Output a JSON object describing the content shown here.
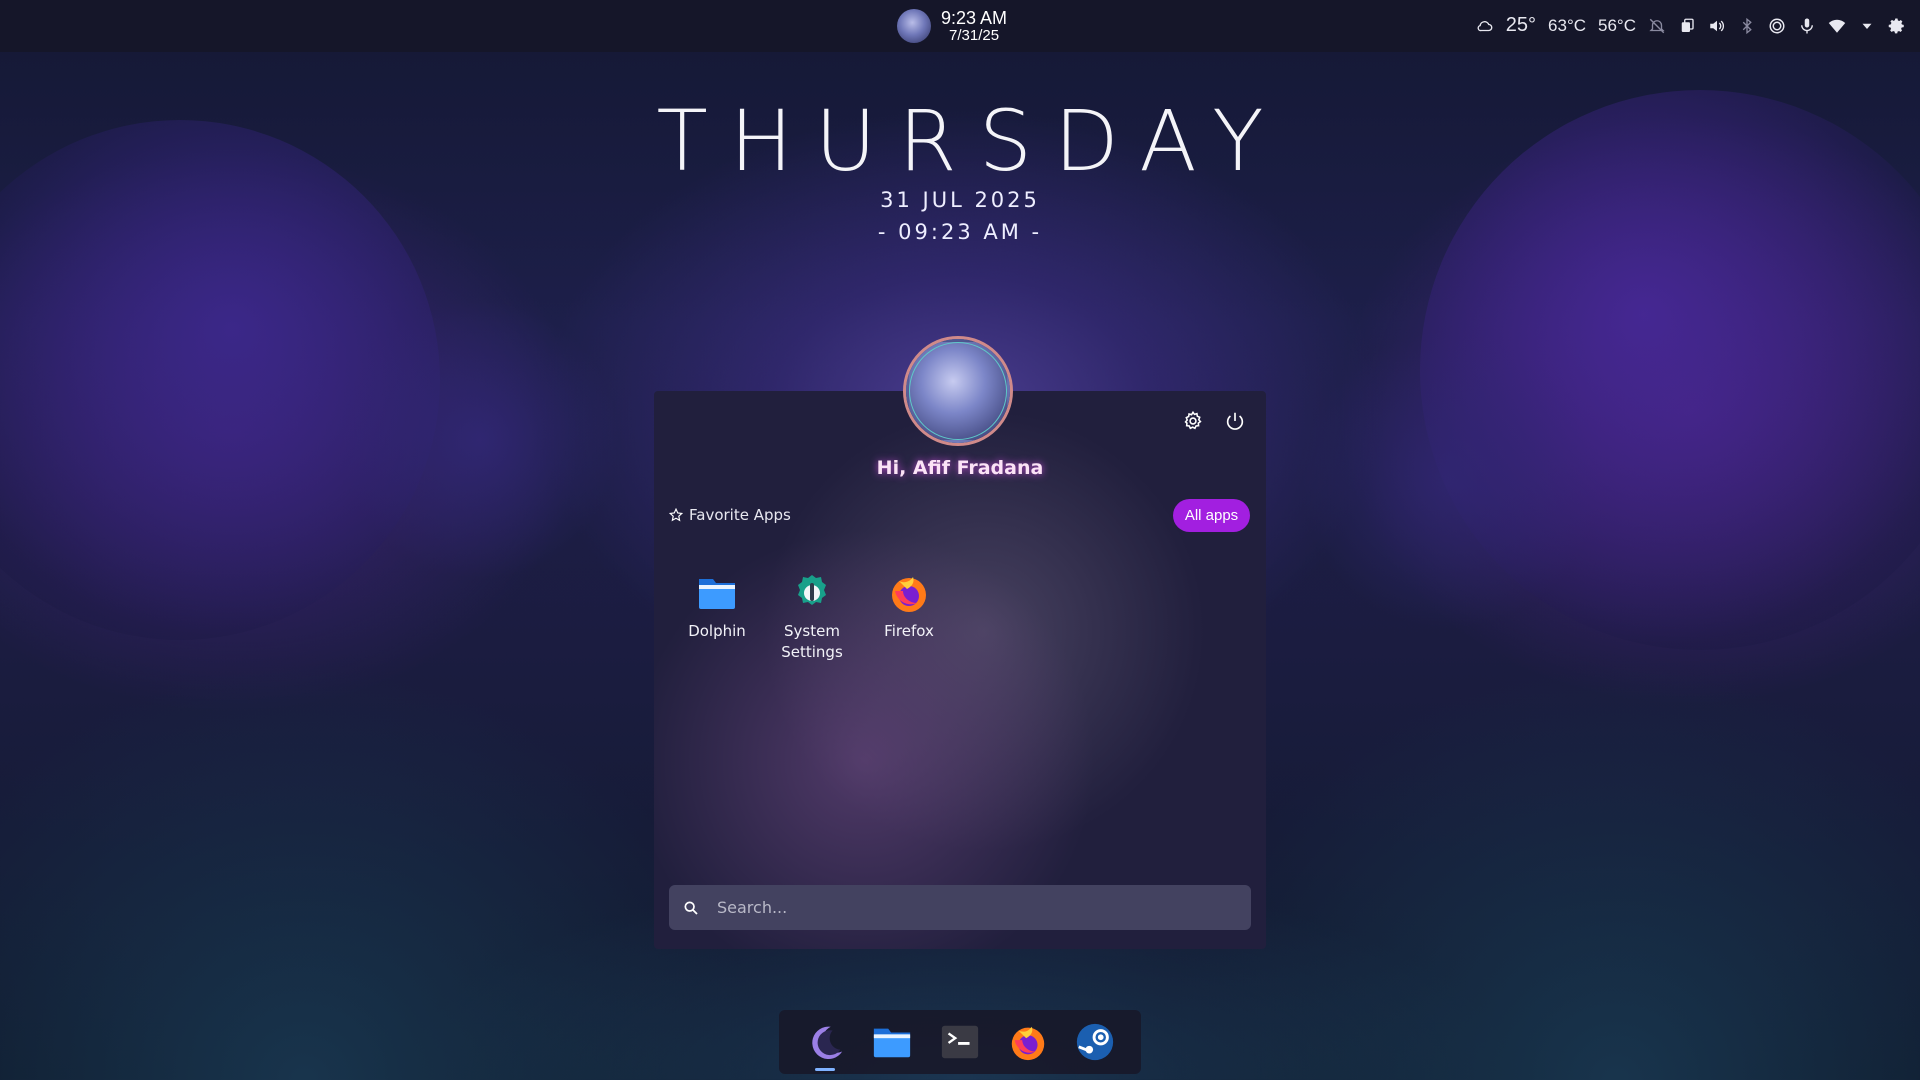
{
  "top_panel": {
    "clock_time": "9:23 AM",
    "clock_date": "7/31/25",
    "weather_temp": "25°",
    "cpu_temp": "63°C",
    "gpu_temp": "56°C",
    "tray_icons": [
      "weather-cloud-icon",
      "notifications-off-icon",
      "clipboard-icon",
      "volume-icon",
      "bluetooth-icon",
      "brightness-icon",
      "microphone-icon",
      "wifi-icon",
      "expand-tray-icon",
      "settings-icon"
    ]
  },
  "desktop_clock": {
    "day": "THURSDAY",
    "date": "31 JUL 2025",
    "time": "- 09:23 AM -"
  },
  "launcher": {
    "greeting": "Hi, Afif Fradana",
    "favorites_label": "Favorite Apps",
    "all_apps_label": "All apps",
    "apps": [
      {
        "name": "Dolphin",
        "icon": "folder-icon"
      },
      {
        "name": "System Settings",
        "icon": "system-settings-icon"
      },
      {
        "name": "Firefox",
        "icon": "firefox-icon"
      }
    ],
    "search_placeholder": "Search..."
  },
  "dock": {
    "items": [
      "launcher-moon-icon",
      "files-icon",
      "terminal-icon",
      "firefox-icon",
      "steam-icon"
    ]
  },
  "colors": {
    "accent": "#a21fe0",
    "panel_bg": "#211f3d",
    "search_bg": "#434260"
  }
}
